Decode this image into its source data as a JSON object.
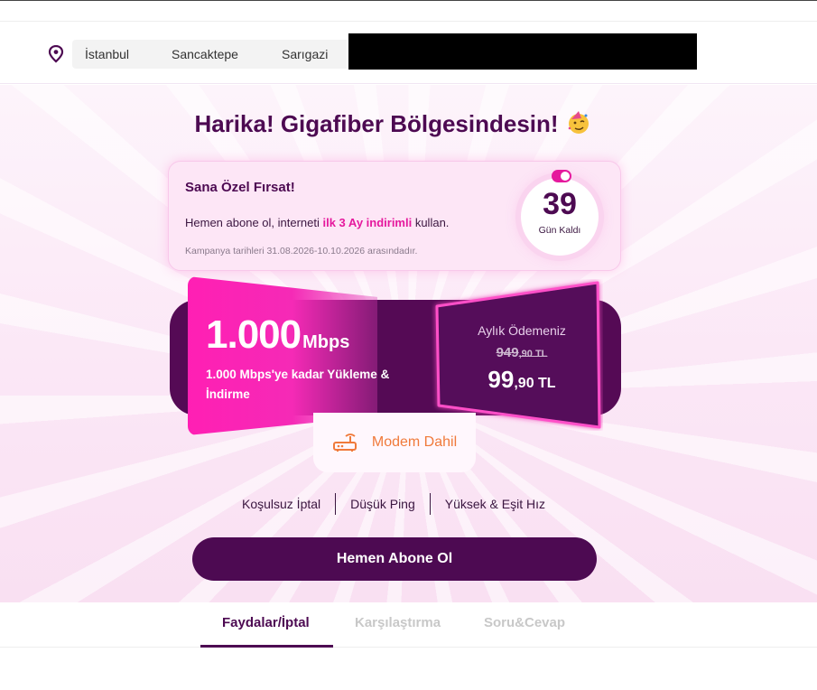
{
  "breadcrumb": {
    "items": [
      {
        "label": "İstanbul"
      },
      {
        "label": "Sancaktepe"
      },
      {
        "label": "Sarıgazi"
      }
    ]
  },
  "hero": {
    "headline": "Harika! Gigafiber Bölgesindesin!",
    "headline_icon": "party-face-icon"
  },
  "offer": {
    "title": "Sana Özel Fırsat!",
    "text_before": "Hemen abone ol, interneti ",
    "text_highlight": "ilk 3 Ay indirimli",
    "text_after": " kullan.",
    "note": "Kampanya tarihleri 31.08.2026-10.10.2026 arasındadır.",
    "days_count": "39",
    "days_label": "Gün Kaldı"
  },
  "plan": {
    "speed_value": "1.000",
    "speed_unit": "Mbps",
    "speed_desc": "1.000 Mbps'ye kadar Yükleme & İndirme",
    "price_label": "Aylık Ödemeniz",
    "old_price_main": "949",
    "old_price_cents": ",90 TL",
    "new_price_main": "99",
    "new_price_cents": ",90 TL",
    "modem_label": "Modem Dahil",
    "modem_icon": "router-icon"
  },
  "features": [
    "Koşulsuz İptal",
    "Düşük Ping",
    "Yüksek & Eşit Hız"
  ],
  "cta": {
    "label": "Hemen Abone Ol"
  },
  "tabs": [
    {
      "label": "Faydalar/İptal",
      "active": true
    },
    {
      "label": "Karşılaştırma",
      "active": false
    },
    {
      "label": "Soru&Cevap",
      "active": false
    }
  ],
  "colors": {
    "brand_purple": "#4d0a52",
    "accent_pink": "#e5199d",
    "modem_orange": "#f07a3b"
  }
}
